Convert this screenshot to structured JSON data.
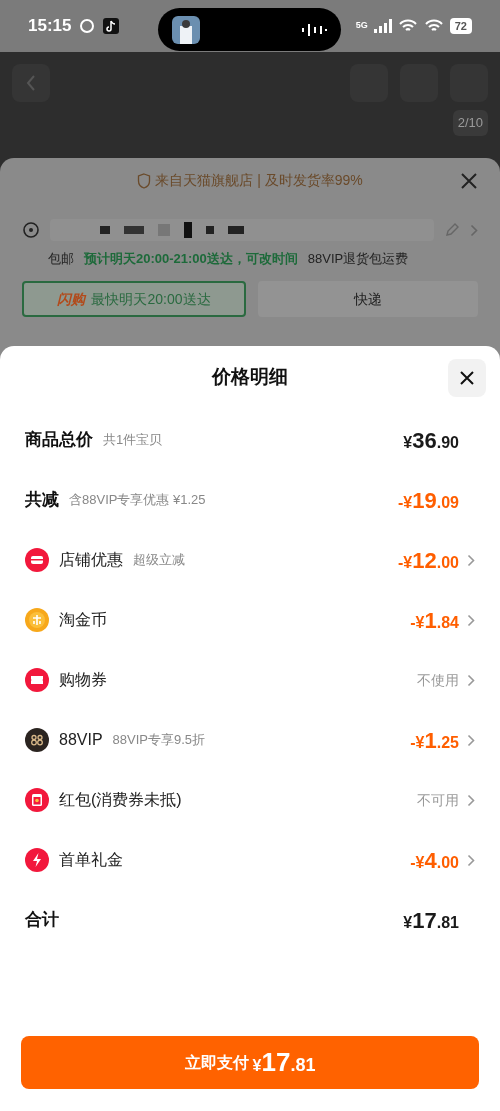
{
  "status_bar": {
    "time": "15:15",
    "network": "5G",
    "battery": "72"
  },
  "background": {
    "page_counter": "2/10",
    "sheet": {
      "banner": "来自天猫旗舰店 | 及时发货率99%",
      "shipping": "包邮",
      "delivery_estimate": "预计明天20:00-21:00送达，可改时间",
      "vip_note": "88VIP退货包运费",
      "options": [
        {
          "badge": "闪购",
          "label": "最快明天20:00送达",
          "selected": true
        },
        {
          "label": "快递",
          "selected": false
        }
      ]
    }
  },
  "price_sheet": {
    "title": "价格明细",
    "rows": [
      {
        "kind": "summary",
        "label": "商品总价",
        "note": "共1件宝贝",
        "discount": false,
        "sign": "¥",
        "whole": "36",
        "fraction": ".90",
        "chevron": false
      },
      {
        "kind": "summary",
        "label": "共减",
        "note": "含88VIP专享优惠 ¥1.25",
        "discount": true,
        "sign": "-¥",
        "whole": "19",
        "fraction": ".09",
        "chevron": false
      },
      {
        "kind": "store",
        "label": "店铺优惠",
        "note": "超级立减",
        "discount": true,
        "sign": "-¥",
        "whole": "12",
        "fraction": ".00",
        "chevron": true
      },
      {
        "kind": "coin",
        "label": "淘金币",
        "discount": true,
        "sign": "-¥",
        "whole": "1",
        "fraction": ".84",
        "chevron": true
      },
      {
        "kind": "coupon",
        "label": "购物券",
        "status": "不使用",
        "chevron": true
      },
      {
        "kind": "vip",
        "label": "88VIP",
        "note": "88VIP专享9.5折",
        "discount": true,
        "sign": "-¥",
        "whole": "1",
        "fraction": ".25",
        "chevron": true
      },
      {
        "kind": "red_packet",
        "label": "红包(消费券未抵)",
        "status": "不可用",
        "chevron": true
      },
      {
        "kind": "gift",
        "label": "首单礼金",
        "discount": true,
        "sign": "-¥",
        "whole": "4",
        "fraction": ".00",
        "chevron": true
      },
      {
        "kind": "summary",
        "label": "合计",
        "discount": false,
        "sign": "¥",
        "whole": "17",
        "fraction": ".81",
        "chevron": false
      }
    ],
    "pay_button": {
      "label": "立即支付",
      "sign": "¥",
      "whole": "17",
      "fraction": ".81"
    }
  }
}
